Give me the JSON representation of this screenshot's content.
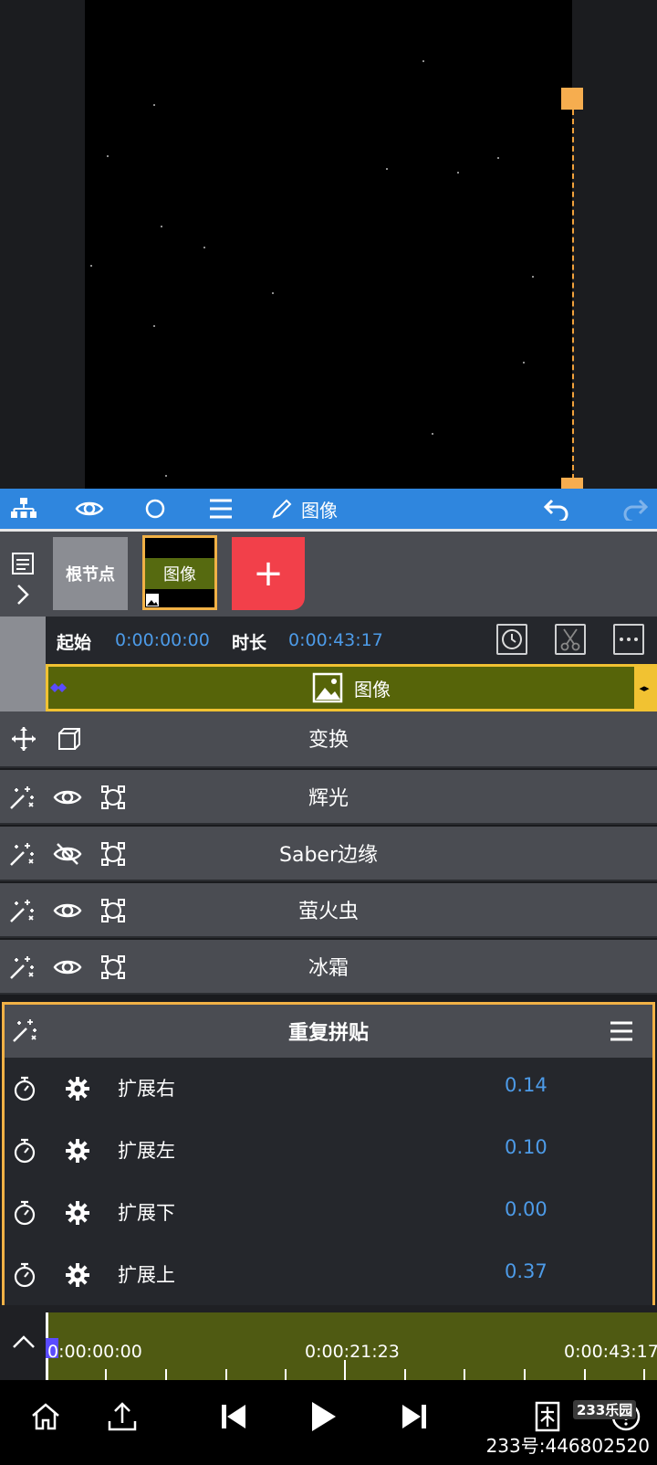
{
  "toolbar": {
    "title": "图像"
  },
  "layers": {
    "root_label": "根节点",
    "image_label": "图像",
    "add_label": "+"
  },
  "time": {
    "start_label": "起始",
    "start_value": "0:00:00:00",
    "duration_label": "时长",
    "duration_value": "0:00:43:17"
  },
  "clip": {
    "label": "图像"
  },
  "transform": {
    "label": "变换"
  },
  "effects": [
    {
      "label": "辉光",
      "visible": true
    },
    {
      "label": "Saber边缘",
      "visible": false
    },
    {
      "label": "萤火虫",
      "visible": true
    },
    {
      "label": "冰霜",
      "visible": true
    }
  ],
  "active_effect": {
    "title": "重复拼贴",
    "params": [
      {
        "label": "扩展右",
        "value": "0.14"
      },
      {
        "label": "扩展左",
        "value": "0.10"
      },
      {
        "label": "扩展下",
        "value": "0.00"
      },
      {
        "label": "扩展上",
        "value": "0.37"
      }
    ]
  },
  "timeline": {
    "start": "0:00:00:00",
    "mid": "0:00:21:23",
    "end": "0:00:43:17"
  },
  "watermark": {
    "badge": "233乐园",
    "text": "233号:446802520"
  },
  "colors": {
    "accent": "#2f86de",
    "highlight": "#f1b146",
    "value": "#4d9be8",
    "clip": "#566409",
    "add": "#f2404a"
  }
}
